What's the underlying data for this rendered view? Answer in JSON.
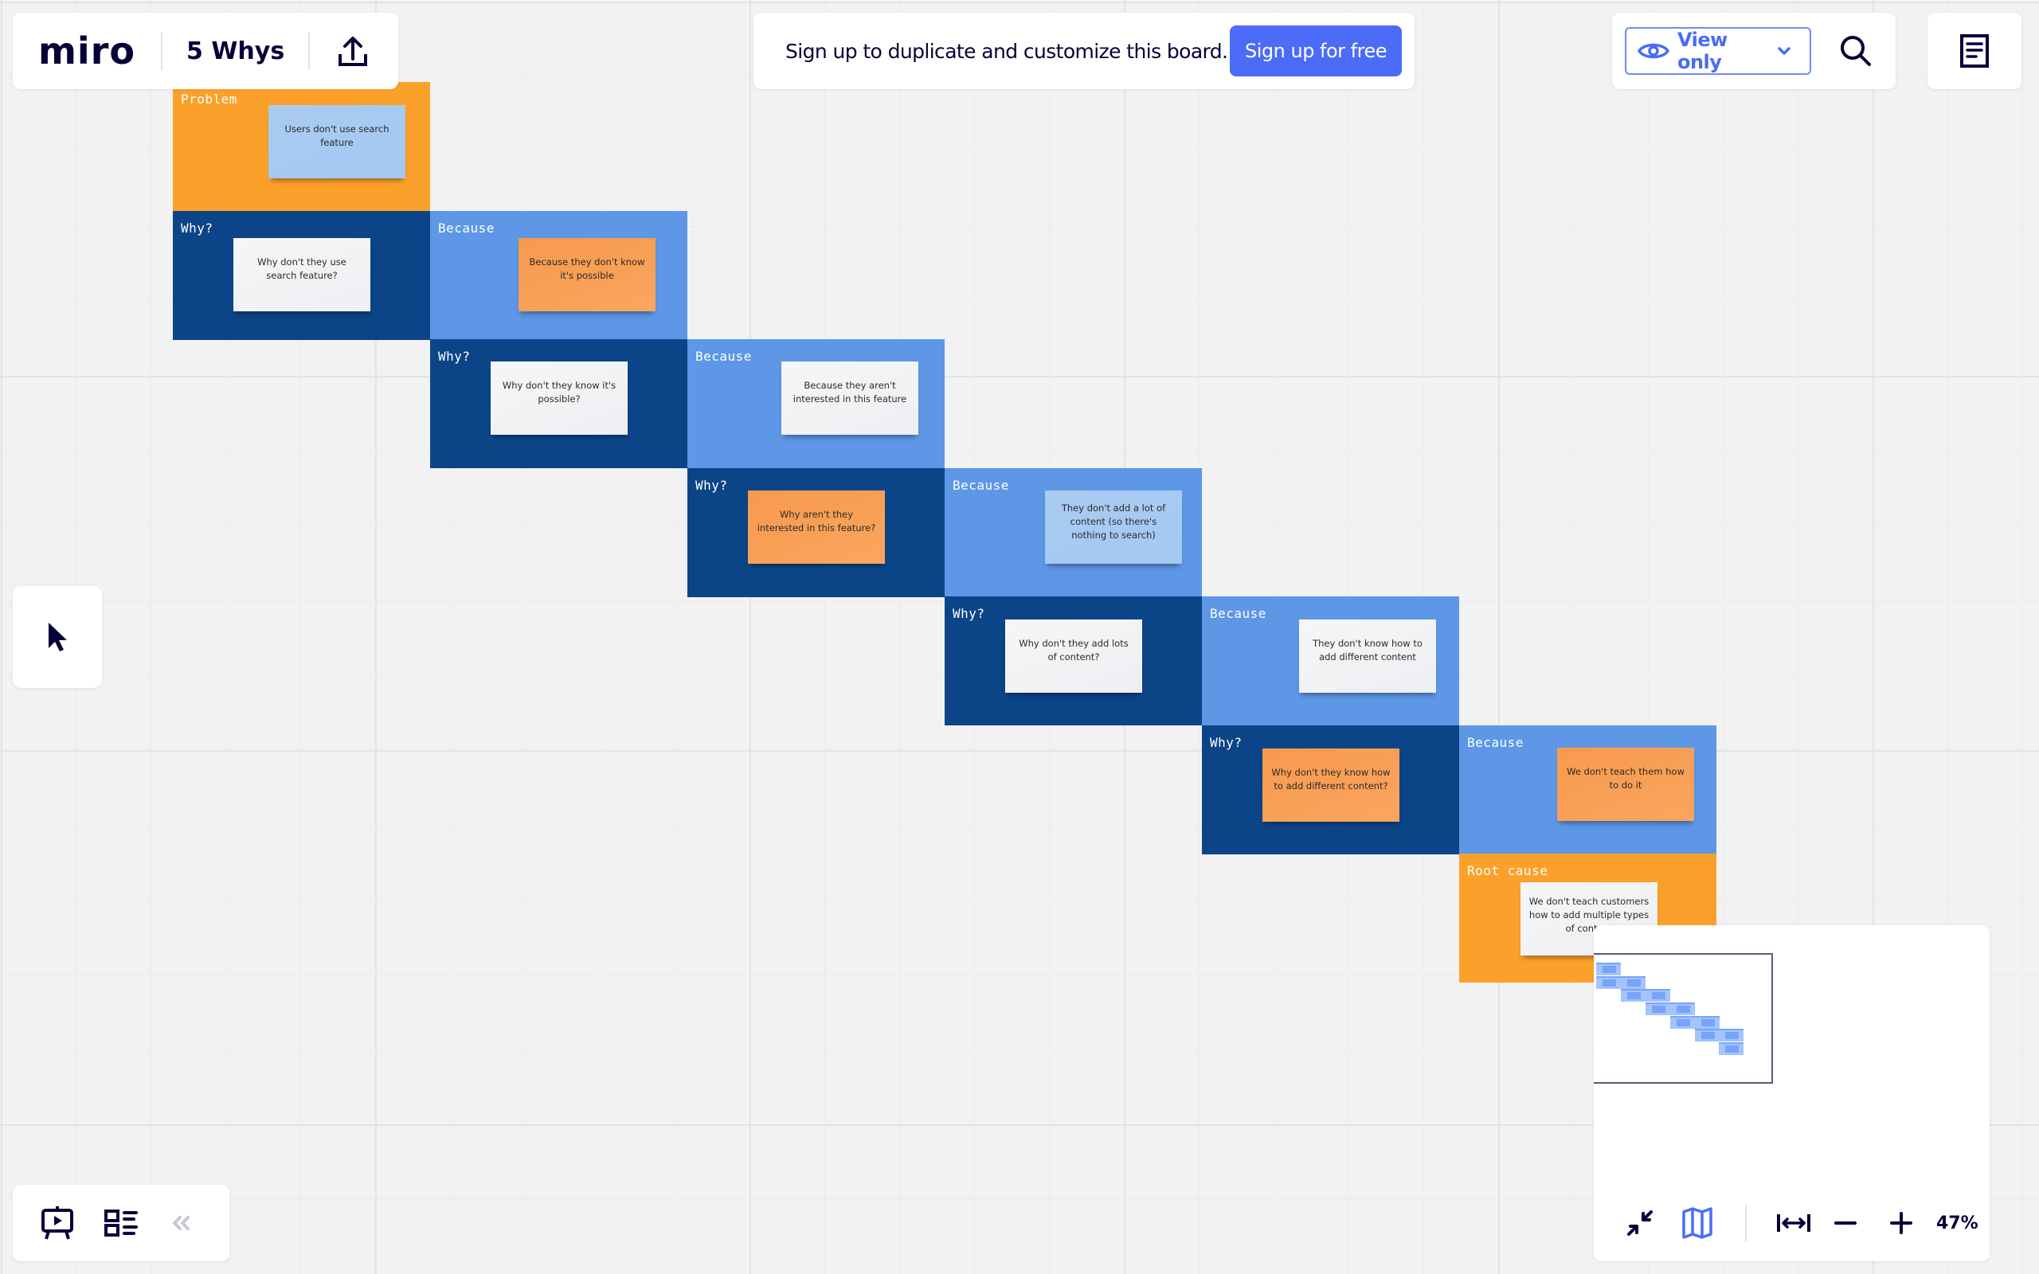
{
  "header": {
    "logo": "miro",
    "board_title": "5 Whys",
    "share_icon": "upload-icon"
  },
  "signup_banner": {
    "message": "Sign up to duplicate and customize this board.",
    "button_label": "Sign up for free"
  },
  "access": {
    "mode_label": "View only",
    "mode_icon": "eye-icon",
    "search_icon": "search-icon",
    "notes_icon": "notes-icon"
  },
  "toolbar": {
    "select_tool_icon": "cursor-icon"
  },
  "bottom_left": {
    "presentation_icon": "presentation-icon",
    "frames_icon": "frames-list-icon",
    "collapse_icon": "double-chevron-left-icon"
  },
  "zoom_panel": {
    "zoom_level": "47%",
    "fit_icon": "collapse-arrows-icon",
    "minimap_icon": "map-icon",
    "fit_width_icon": "fit-width-icon",
    "zoom_out_icon": "minus-icon",
    "zoom_in_icon": "plus-icon"
  },
  "colors": {
    "accent": "#4a6cf7",
    "problem_frame": "#fba12b",
    "why_frame": "#0c4587",
    "because_frame": "#5d97e6",
    "sticky_orange": "#f89f55",
    "sticky_white": "#f2f3f5",
    "sticky_lightblue": "#a6c9f1"
  },
  "board": {
    "frames": [
      {
        "type": "problem",
        "label": "Problem",
        "sticky": {
          "text": "Users don't use search feature",
          "color": "lightblue"
        }
      },
      {
        "type": "why",
        "label": "Why?",
        "sticky": {
          "text": "Why don't they use search feature?",
          "color": "white"
        }
      },
      {
        "type": "because",
        "label": "Because",
        "sticky": {
          "text": "Because they don't know it's possible",
          "color": "orange"
        }
      },
      {
        "type": "why",
        "label": "Why?",
        "sticky": {
          "text": "Why don't they know it's possible?",
          "color": "white"
        }
      },
      {
        "type": "because",
        "label": "Because",
        "sticky": {
          "text": "Because they aren't interested in this feature",
          "color": "white"
        }
      },
      {
        "type": "why",
        "label": "Why?",
        "sticky": {
          "text": "Why aren't they interested in this feature?",
          "color": "orange"
        }
      },
      {
        "type": "because",
        "label": "Because",
        "sticky": {
          "text": "They don't add a lot of content (so there's nothing to search)",
          "color": "lightblue"
        }
      },
      {
        "type": "why",
        "label": "Why?",
        "sticky": {
          "text": "Why don't they add lots of content?",
          "color": "white"
        }
      },
      {
        "type": "because",
        "label": "Because",
        "sticky": {
          "text": "They don't know how to add different content",
          "color": "white"
        }
      },
      {
        "type": "why",
        "label": "Why?",
        "sticky": {
          "text": "Why don't they know how to add different content?",
          "color": "orange"
        }
      },
      {
        "type": "because",
        "label": "Because",
        "sticky": {
          "text": "We don't teach them how to do it",
          "color": "orange"
        }
      },
      {
        "type": "root",
        "label": "Root cause",
        "sticky": {
          "text": "We don't teach customers how to add multiple types of content",
          "color": "white"
        }
      }
    ]
  }
}
